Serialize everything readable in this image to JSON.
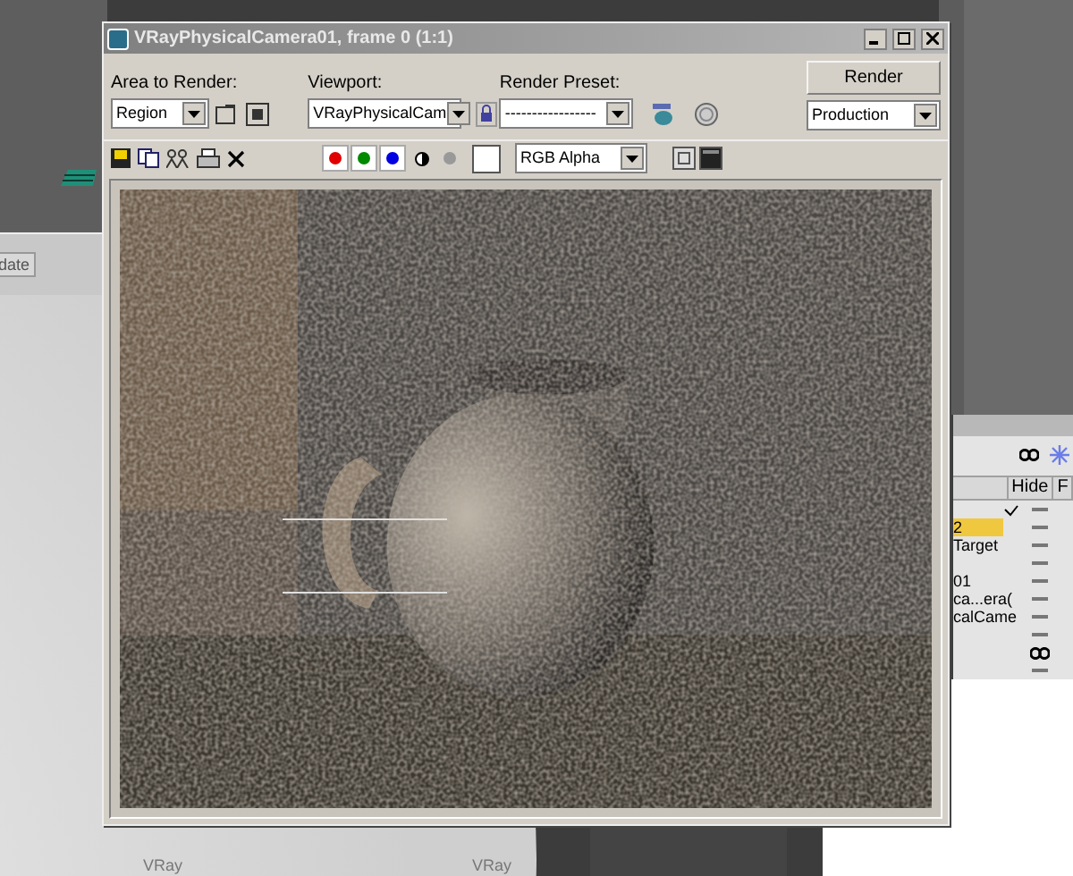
{
  "window": {
    "title": "VRayPhysicalCamera01, frame 0 (1:1)"
  },
  "area_to_render": {
    "label": "Area to Render:",
    "value": "Region"
  },
  "viewport": {
    "label": "Viewport:",
    "value": "VRayPhysicalCam"
  },
  "render_preset": {
    "label": "Render Preset:",
    "value": "-----------------"
  },
  "render_button": "Render",
  "production": "Production",
  "channels": [
    {
      "kind": "color",
      "color": "#e00000"
    },
    {
      "kind": "color",
      "color": "#008a00"
    },
    {
      "kind": "color",
      "color": "#0000e0"
    },
    {
      "kind": "alpha"
    },
    {
      "kind": "mono"
    }
  ],
  "display": "RGB Alpha",
  "background": {
    "update_button": "date",
    "viewport_labels": [
      "VRay",
      "VRay"
    ]
  },
  "scene_explorer": {
    "columns": [
      "Hide",
      "F"
    ],
    "rows": [
      {
        "checked": true,
        "selected": false,
        "hidden": false
      },
      {
        "name": "2",
        "checked": false,
        "selected": true,
        "hidden": false
      },
      {
        "name": "Target",
        "checked": false,
        "selected": false,
        "hidden": false
      },
      {
        "checked": false,
        "selected": false,
        "hidden": false
      },
      {
        "name": "01",
        "checked": false,
        "selected": false,
        "hidden": false
      },
      {
        "name": "ca...era(",
        "checked": false,
        "selected": false,
        "hidden": false
      },
      {
        "name": "calCame",
        "checked": false,
        "selected": false,
        "hidden": false
      },
      {
        "checked": false,
        "selected": false,
        "hidden": false
      },
      {
        "checked": false,
        "selected": false,
        "hidden": true
      },
      {
        "checked": false,
        "selected": false,
        "hidden": false
      }
    ]
  }
}
